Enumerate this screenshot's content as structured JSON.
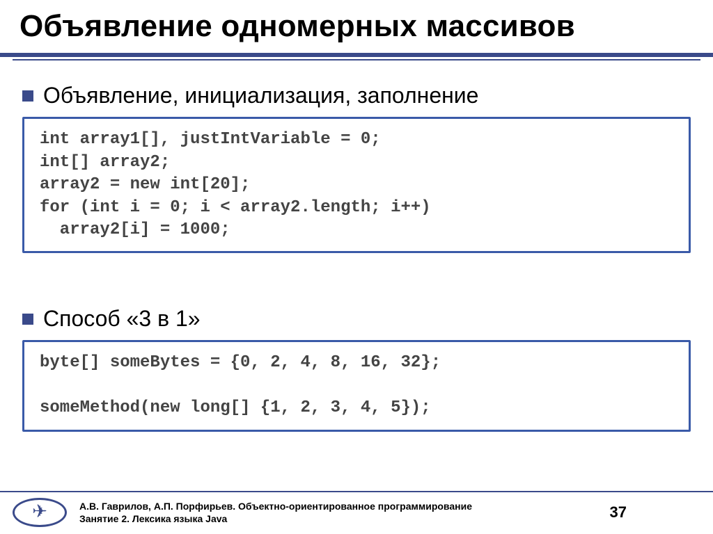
{
  "title": "Объявление одномерных массивов",
  "bullets": {
    "first": "Объявление, инициализация, заполнение",
    "second": "Способ «3 в 1»"
  },
  "code1": {
    "l1": "int array1[], justIntVariable = 0;",
    "l2": "int[] array2;",
    "l3": "array2 = new int[20];",
    "l4": "for (int i = 0; i < array2.length; i++)",
    "l5": "  array2[i] = 1000;"
  },
  "code2": {
    "l1": "byte[] someBytes = {0, 2, 4, 8, 16, 32};",
    "blank": " ",
    "l2": "someMethod(new long[] {1, 2, 3, 4, 5});"
  },
  "footer": {
    "authors": "А.В. Гаврилов, А.П. Порфирьев. Объектно-ориентированное программирование",
    "subtitle": "Занятие 2. Лексика языка Java",
    "page": "37",
    "logo_glyph": "✈"
  }
}
